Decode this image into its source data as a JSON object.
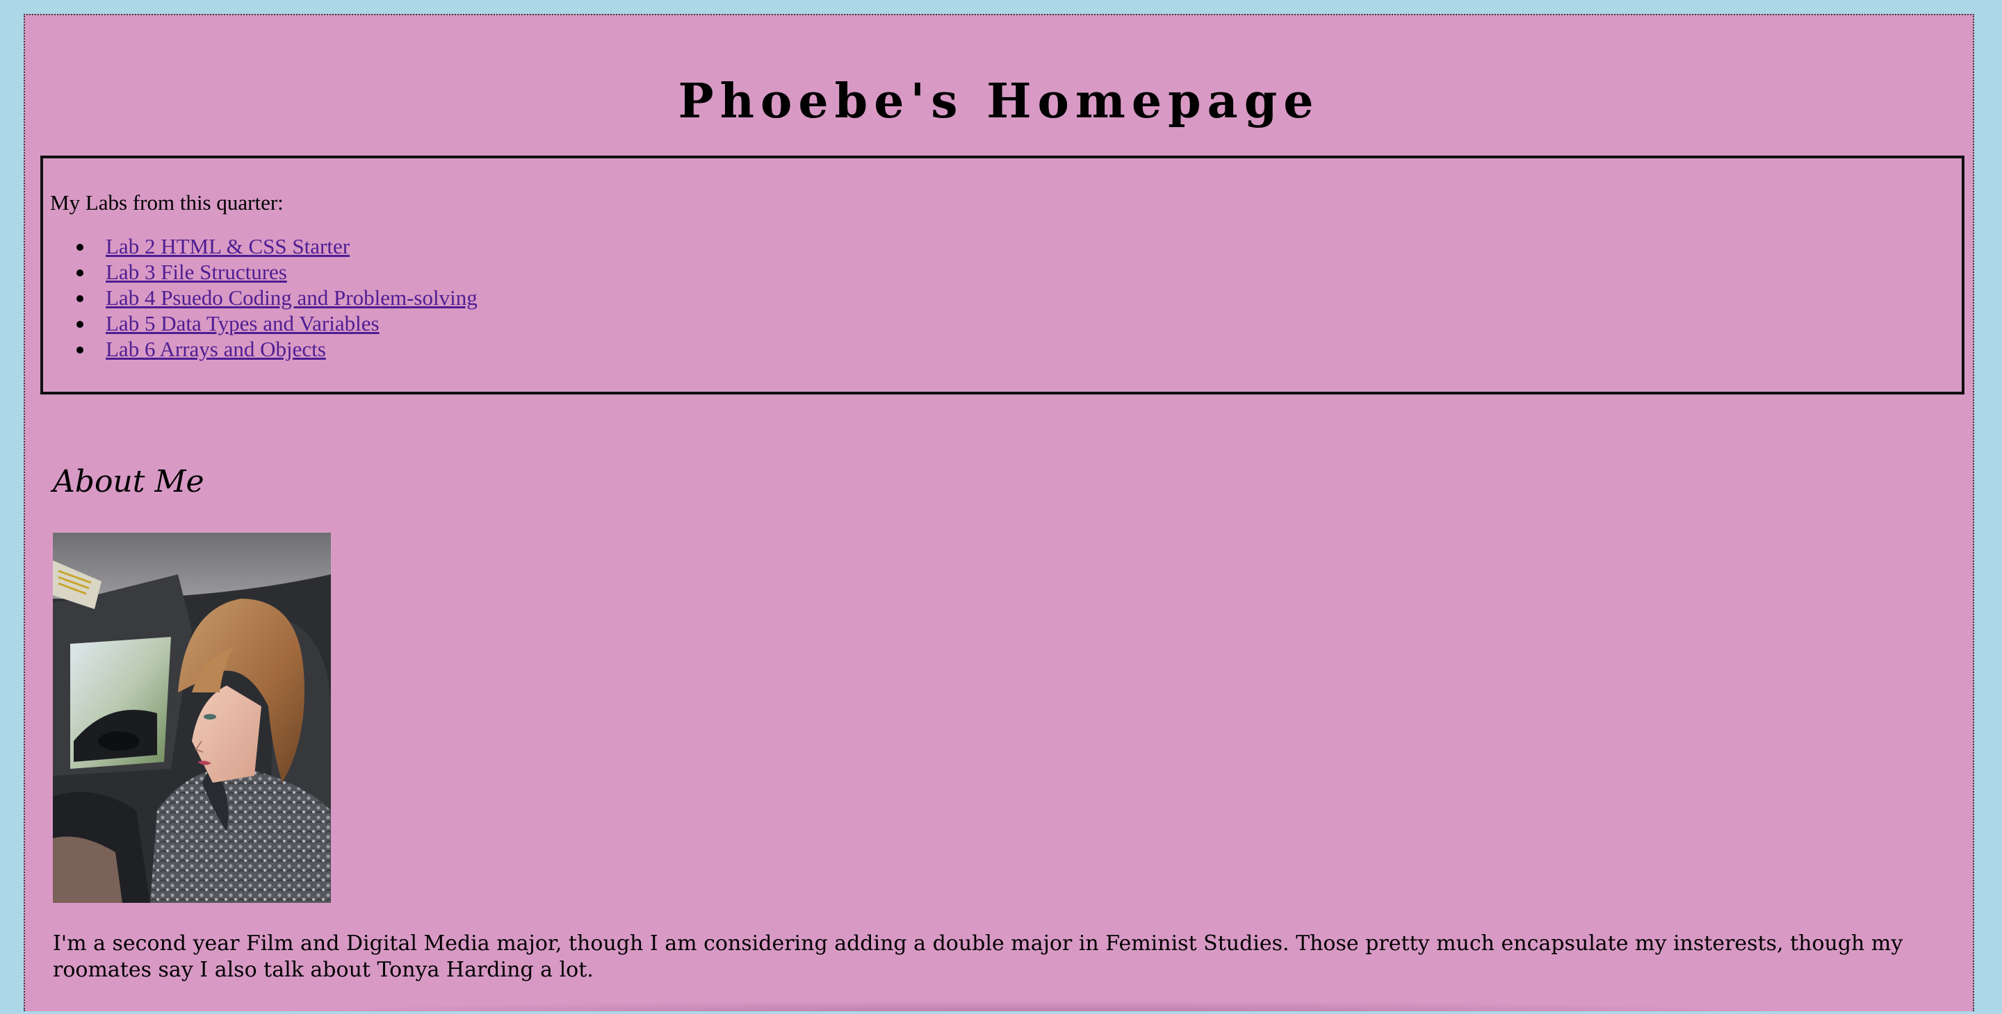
{
  "page": {
    "title": "Phoebe's Homepage",
    "background_color": "#d89ac5",
    "frame_color": "#acd7e6"
  },
  "labs": {
    "intro": "My Labs from this quarter:",
    "link_color": "#4f1d92",
    "items": [
      {
        "label": "Lab 2 HTML & CSS Starter"
      },
      {
        "label": "Lab 3 File Structures"
      },
      {
        "label": "Lab 4 Psuedo Coding and Problem-solving"
      },
      {
        "label": "Lab 5 Data Types and Variables"
      },
      {
        "label": "Lab 6 Arrays and Objects"
      }
    ]
  },
  "about": {
    "heading": "About Me",
    "photo": "profile-photo",
    "text": "I'm a second year Film and Digital Media major, though I am considering adding a double major in Feminist Studies. Those pretty much encapsulate my insterests, though my roomates say I also talk about Tonya Harding a lot."
  }
}
